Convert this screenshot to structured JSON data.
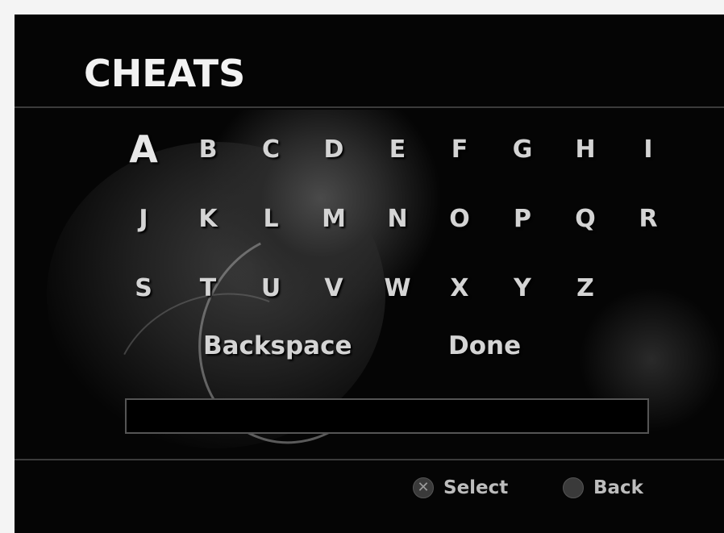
{
  "title": "CHEATS",
  "keyboard": {
    "selected": "A",
    "rows": [
      [
        "A",
        "B",
        "C",
        "D",
        "E",
        "F",
        "G",
        "H",
        "I"
      ],
      [
        "J",
        "K",
        "L",
        "M",
        "N",
        "O",
        "P",
        "Q",
        "R"
      ],
      [
        "S",
        "T",
        "U",
        "V",
        "W",
        "X",
        "Y",
        "Z"
      ]
    ]
  },
  "actions": {
    "backspace": "Backspace",
    "done": "Done"
  },
  "entry_value": "",
  "hints": {
    "select_label": "Select",
    "select_icon": "cross-button-icon",
    "back_label": "Back",
    "back_icon": "circle-button-icon"
  },
  "colors": {
    "background": "#050505",
    "text": "#d4d4d4",
    "title": "#f2f2f2"
  }
}
